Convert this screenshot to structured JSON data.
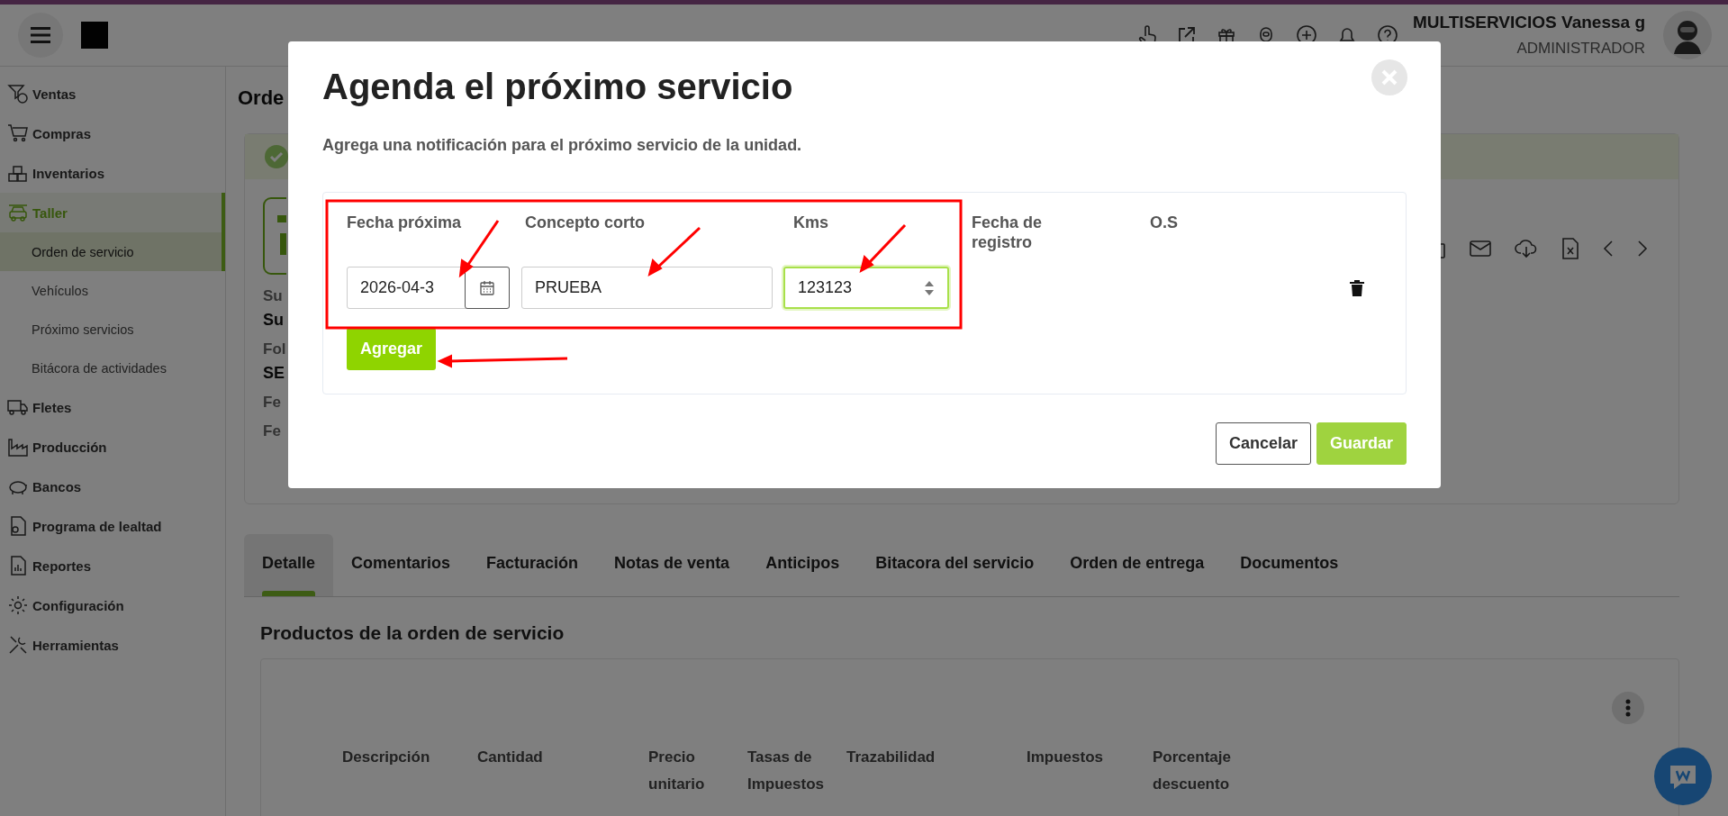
{
  "topbar": {
    "user_name": "MULTISERVICIOS Vanessa g",
    "role": "ADMINISTRADOR"
  },
  "sidebar": {
    "items": [
      {
        "label": "Ventas",
        "selected": false
      },
      {
        "label": "Compras",
        "selected": false
      },
      {
        "label": "Inventarios",
        "selected": false
      },
      {
        "label": "Taller",
        "selected": true,
        "children": [
          {
            "label": "Orden de servicio",
            "selected": true
          },
          {
            "label": "Vehículos",
            "selected": false
          },
          {
            "label": "Próximo servicios",
            "selected": false
          },
          {
            "label": "Bitácora de actividades",
            "selected": false
          }
        ]
      },
      {
        "label": "Fletes",
        "selected": false
      },
      {
        "label": "Producción",
        "selected": false
      },
      {
        "label": "Bancos",
        "selected": false
      },
      {
        "label": "Programa de lealtad",
        "selected": false
      },
      {
        "label": "Reportes",
        "selected": false
      },
      {
        "label": "Configuración",
        "selected": false
      },
      {
        "label": "Herramientas",
        "selected": false
      }
    ]
  },
  "page": {
    "title": "Orde",
    "fields": [
      {
        "label": "Su",
        "value": "Su"
      },
      {
        "label": "Fol",
        "value": "SE"
      },
      {
        "label": "Fe"
      },
      {
        "label": "Fe"
      }
    ]
  },
  "tabs": [
    {
      "label": "Detalle",
      "selected": true
    },
    {
      "label": "Comentarios",
      "selected": false
    },
    {
      "label": "Facturación",
      "selected": false
    },
    {
      "label": "Notas de venta",
      "selected": false
    },
    {
      "label": "Anticipos",
      "selected": false
    },
    {
      "label": "Bitacora del servicio",
      "selected": false
    },
    {
      "label": "Orden de entrega",
      "selected": false
    },
    {
      "label": "Documentos",
      "selected": false
    }
  ],
  "products": {
    "title": "Productos de la orden de servicio",
    "columns": [
      "Descripción",
      "Cantidad",
      "Precio unitario",
      "Tasas de Impuestos",
      "Trazabilidad",
      "Impuestos",
      "Porcentaje descuento"
    ]
  },
  "modal": {
    "title": "Agenda el próximo servicio",
    "subtitle": "Agrega una notificación para el próximo servicio de la unidad.",
    "columns": [
      "Fecha próxima",
      "Concepto corto",
      "Kms",
      "Fecha de registro",
      "O.S"
    ],
    "entry": {
      "date": "2026-04-3",
      "concept": "PRUEBA",
      "kms": "123123",
      "kms_focused": true
    },
    "add_button": "Agregar",
    "buttons": [
      {
        "label": "Cancelar",
        "kind": "secondary",
        "disabled": false
      },
      {
        "label": "Guardar",
        "kind": "primary",
        "disabled": true
      }
    ]
  }
}
